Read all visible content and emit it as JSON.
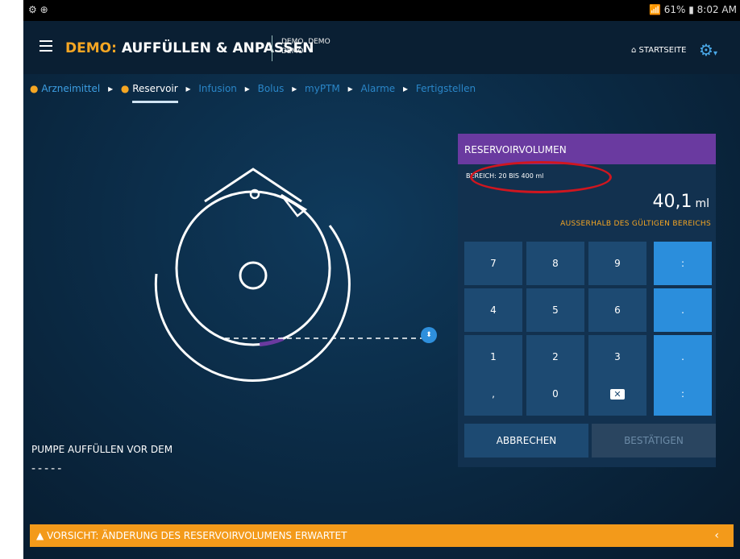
{
  "status": {
    "left_icons": "⚙ ⊕",
    "battery": "61%",
    "time": "8:02 AM"
  },
  "header": {
    "title_prefix": "DEMO:",
    "title": "AUFFÜLLEN & ANPASSEN",
    "user_line1": "DEMO, DEMO",
    "user_line2": "DEMO",
    "home_label": "STARTSEITE"
  },
  "breadcrumbs": [
    "Arzneimittel",
    "Reservoir",
    "Infusion",
    "Bolus",
    "myPTM",
    "Alarme",
    "Fertigstellen"
  ],
  "pump": {
    "fill_label": "PUMPE AUFFÜLLEN VOR DEM",
    "fill_value": "-----"
  },
  "panel": {
    "title": "RESERVOIRVOLUMEN",
    "range": "BEREICH: 20 BIS 400 ml",
    "value": "40,1",
    "unit": "ml",
    "error": "AUSSERHALB DES GÜLTIGEN BEREICHS",
    "keys": [
      "7",
      "8",
      "9",
      "4",
      "5",
      "6",
      "1",
      "2",
      "3",
      ",",
      "0"
    ],
    "side_keys": [
      ":",
      ".",
      ".",
      ":"
    ],
    "cancel": "ABBRECHEN",
    "confirm": "BESTÄTIGEN"
  },
  "warning": {
    "text": "VORSICHT: ÄNDERUNG DES RESERVOIRVOLUMENS ERWARTET",
    "icon": "▲"
  },
  "colors": {
    "accent": "#f5a623",
    "purple": "#6a3aa0",
    "blue": "#2b8edc",
    "annotation": "#d0161f"
  }
}
